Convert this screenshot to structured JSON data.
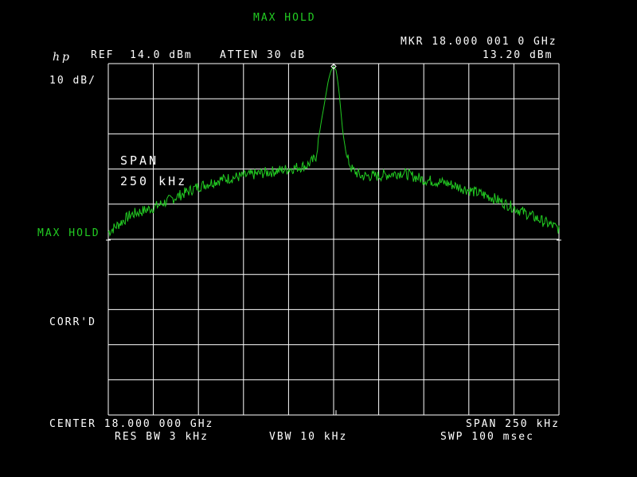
{
  "screen": {
    "mode_title": "MAX HOLD",
    "logo": "hp",
    "ref_level": "REF  14.0 dBm",
    "attenuation": "ATTEN 30 dB",
    "marker_freq": "MKR 18.000 001 0 GHz",
    "marker_level": "13.20 dBm",
    "scale": "10 dB/",
    "side_mode": "MAX HOLD",
    "corrected": "CORR'D",
    "span_annotation_label": "SPAN",
    "span_annotation_value": "250 kHz",
    "center_freq": "CENTER 18.000 000 GHz",
    "span": "SPAN 250 kHz",
    "res_bw": "RES BW 3 kHz",
    "vbw": "VBW 10 kHz",
    "sweep": "SWP 100 msec"
  },
  "colors": {
    "background": "#000000",
    "text": "#ffffff",
    "trace": "#22cc22",
    "graticule": "#ffffff"
  },
  "chart_data": {
    "type": "line",
    "title": "",
    "xlabel": "",
    "ylabel": "",
    "xlim": [
      -125,
      125
    ],
    "ylim": [
      -86,
      14
    ],
    "x_unit": "kHz offset from 18.000 000 GHz",
    "y_unit": "dBm",
    "grid": true,
    "series": [
      {
        "x": [
          -125,
          -112.5,
          -100,
          -87.5,
          -75,
          -62.5,
          -50,
          -37.5,
          -25,
          -15,
          -10,
          -7,
          -5,
          -3,
          -1.5,
          0,
          1.5,
          3,
          5,
          7,
          10,
          15,
          25,
          37.5,
          50,
          62.5,
          75,
          87.5,
          100,
          112.5,
          125
        ],
        "values": [
          -34,
          -29,
          -27,
          -24,
          -21,
          -19,
          -18,
          -17,
          -16,
          -15,
          -13,
          -3,
          3,
          9,
          12,
          13.2,
          12,
          6,
          -5,
          -12,
          -16,
          -18,
          -18,
          -17,
          -19,
          -20,
          -22,
          -24,
          -27,
          -30,
          -33
        ]
      }
    ],
    "marker": {
      "x": 0.001,
      "value": 13.2
    }
  }
}
